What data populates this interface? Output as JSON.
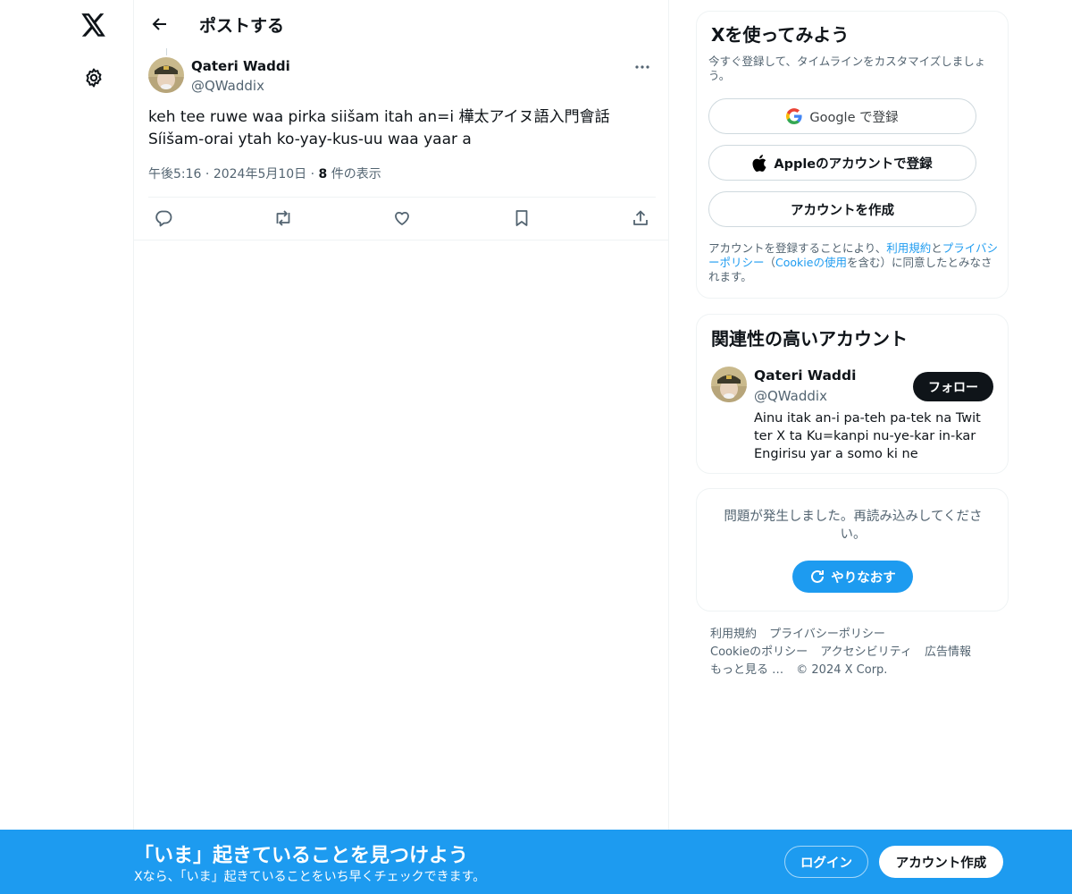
{
  "nav": {
    "logo_icon": "x-logo-icon",
    "settings_icon": "gear-icon"
  },
  "header": {
    "title": "ポストする"
  },
  "post": {
    "author_name": "Qateri Waddi",
    "author_handle": "@QWaddix",
    "text": "keh tee ruwe waa pirka siišam itah an=i 樺太アイヌ語入門會話Síišam-orai ytah ko-yay-kus-uu waa yaar a",
    "time": "午後5:16",
    "date": "2024年5月10日",
    "views_count": "8",
    "views_label": "件の表示"
  },
  "signup_card": {
    "title": "Xを使ってみよう",
    "description": "今すぐ登録して、タイムラインをカスタマイズしましょう。",
    "google_label": "Google で登録",
    "apple_label": "Appleのアカウントで登録",
    "create_label": "アカウントを作成",
    "legal_prefix": "アカウントを登録することにより、",
    "terms": "利用規約",
    "and": "と",
    "privacy": "プライバシーポリシー",
    "paren_open": "（",
    "cookie": "Cookieの使用",
    "legal_suffix": "を含む）に同意したとみなされます。"
  },
  "related": {
    "title": "関連性の高いアカウント",
    "name": "Qateri Waddi",
    "handle": "@QWaddix",
    "bio": "Ainu itak an-i pa-teh pa-tek na Twit ter X ta Ku=kanpi nu-ye-kar in-kar Engirisu yar a somo ki ne",
    "follow_label": "フォロー"
  },
  "error_card": {
    "message": "問題が発生しました。再読み込みしてください。",
    "retry_label": "やりなおす"
  },
  "footer": {
    "terms": "利用規約",
    "privacy": "プライバシーポリシー",
    "cookie": "Cookieのポリシー",
    "accessibility": "アクセシビリティ",
    "ads": "広告情報",
    "more": "もっと見る …",
    "copyright": "© 2024 X Corp."
  },
  "banner": {
    "title": "「いま」起きていることを見つけよう",
    "subtitle": "Xなら、「いま」起きていることをいち早くチェックできます。",
    "login_label": "ログイン",
    "signup_label": "アカウント作成"
  },
  "colors": {
    "accent": "#1d9bf0",
    "text": "#0f1419",
    "secondary": "#536471",
    "border": "#eff3f4"
  }
}
